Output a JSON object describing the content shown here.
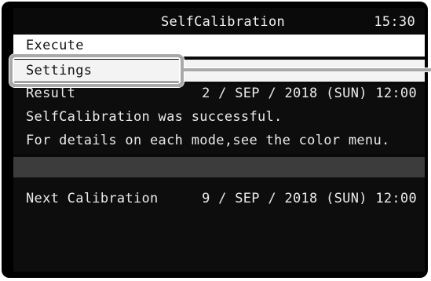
{
  "header": {
    "title": "SelfCalibration",
    "time": "15:30"
  },
  "menu": {
    "items": [
      {
        "label": "Execute"
      },
      {
        "label": "Settings"
      }
    ]
  },
  "result": {
    "label": "Result",
    "date": "2 / SEP / 2018 (SUN) 12:00",
    "message": "SelfCalibration was successful.",
    "detail": "For details on each mode,see the color menu."
  },
  "next_calibration": {
    "label": "Next Calibration",
    "date": "9 / SEP / 2018 (SUN) 12:00"
  },
  "colors": {
    "background": "#0a0a0a",
    "highlight": "#ffffff",
    "separator": "#3c3c3c",
    "callout": "#a9a9a9"
  }
}
